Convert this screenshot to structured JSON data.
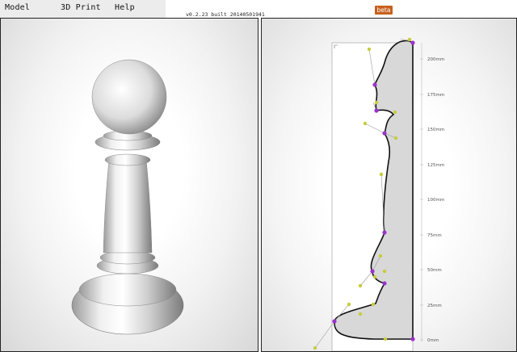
{
  "menu": {
    "items": [
      "Model",
      "3D Print",
      "Help"
    ]
  },
  "version_text": "v0.2.23 built 20140501941",
  "beta_label": "beta",
  "profile_editor": {
    "axis_unit": "mm",
    "tick_labels": [
      "200mm",
      "175mm",
      "150mm",
      "125mm",
      "100mm",
      "75mm",
      "50mm",
      "25mm",
      "0mm"
    ],
    "tick_values": [
      200,
      175,
      150,
      125,
      100,
      75,
      50,
      25,
      0
    ]
  },
  "colors": {
    "accent": "#c8601c",
    "control_point": "#9a33cc",
    "handle_point": "#c8cc3c",
    "profile_fill": "#d8d8d8"
  }
}
